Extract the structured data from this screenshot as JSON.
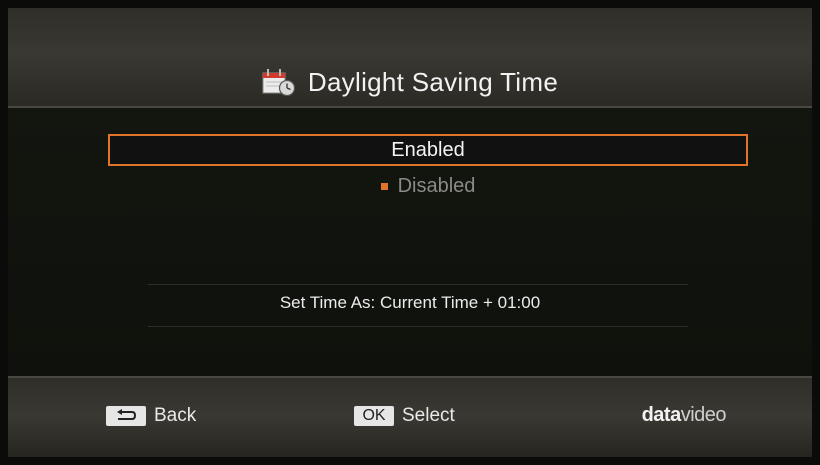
{
  "header": {
    "title": "Daylight Saving Time",
    "icon": "calendar-clock-icon"
  },
  "options": [
    {
      "label": "Enabled",
      "selected": false,
      "focused": true
    },
    {
      "label": "Disabled",
      "selected": true,
      "focused": false
    }
  ],
  "status": {
    "text": "Set Time As: Current Time + 01:00"
  },
  "footer": {
    "back_label": "Back",
    "ok_key": "OK",
    "select_label": "Select",
    "logo_part1": "data",
    "logo_part2": "video"
  },
  "colors": {
    "accent": "#e0752a",
    "text": "#f2f2f2",
    "muted": "#8a8a86"
  }
}
